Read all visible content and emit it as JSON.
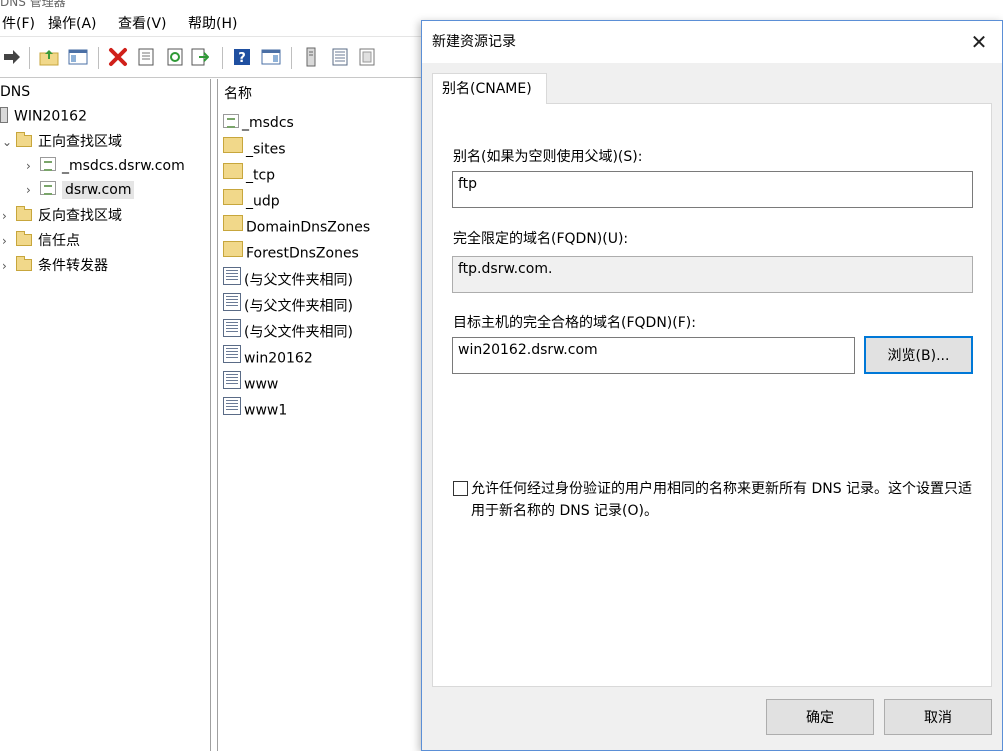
{
  "app": {
    "title": "DNS 管理器"
  },
  "menu": [
    "件(F)",
    "操作(A)",
    "查看(V)",
    "帮助(H)"
  ],
  "tree": {
    "root": "DNS",
    "server": "WIN20162",
    "forward_zones": "正向查找区域",
    "zone_msdcs": "_msdcs.dsrw.com",
    "zone_dsrw": "dsrw.com",
    "reverse_zones": "反向查找区域",
    "trust_points": "信任点",
    "conditional_forwarders": "条件转发器"
  },
  "list": {
    "column_name": "名称",
    "items": [
      "_msdcs",
      "_sites",
      "_tcp",
      "_udp",
      "DomainDnsZones",
      "ForestDnsZones",
      "(与父文件夹相同)",
      "(与父文件夹相同)",
      "(与父文件夹相同)",
      "win20162",
      "www",
      "www1"
    ]
  },
  "dialog": {
    "title": "新建资源记录",
    "close_glyph": "✕",
    "tab": "别名(CNAME)",
    "alias_label": "别名(如果为空则使用父域)(S):",
    "alias_value": "ftp",
    "fqdn_label": "完全限定的域名(FQDN)(U):",
    "fqdn_value": "ftp.dsrw.com.",
    "target_label": "目标主机的完全合格的域名(FQDN)(F):",
    "target_value": "win20162.dsrw.com",
    "browse_label": "浏览(B)...",
    "checkbox_label": "允许任何经过身份验证的用户用相同的名称来更新所有 DNS 记录。这个设置只适用于新名称的 DNS 记录(O)。",
    "checkbox_checked": false,
    "ok_label": "确定",
    "cancel_label": "取消"
  }
}
